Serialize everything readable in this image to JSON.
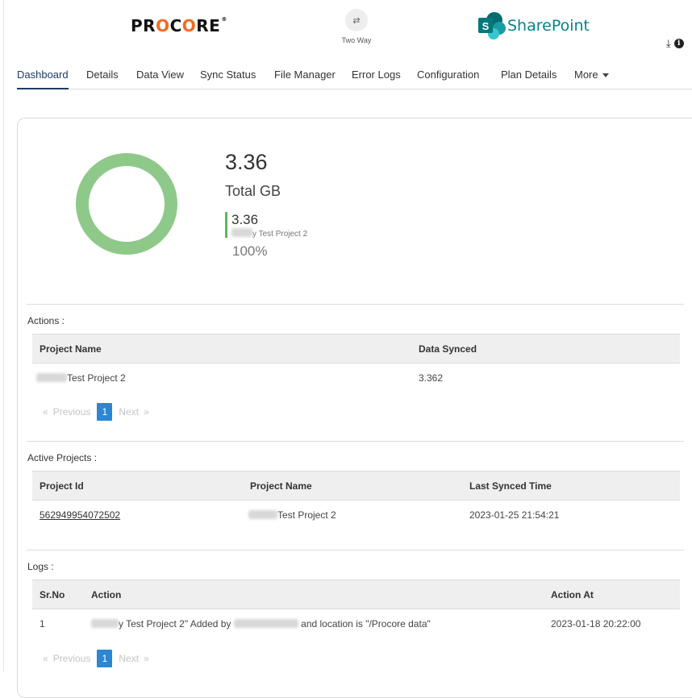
{
  "header": {
    "left_logo": "PROCORE",
    "sync_icon": "arrows-swap-icon",
    "sync_label": "Two Way",
    "right_logo": "SharePoint",
    "download_icon": "download-icon",
    "info_icon": "info-icon"
  },
  "tabs": [
    {
      "label": "Dashboard",
      "active": true
    },
    {
      "label": "Details"
    },
    {
      "label": "Data View"
    },
    {
      "label": "Sync Status"
    },
    {
      "label": "File Manager"
    },
    {
      "label": "Error Logs"
    },
    {
      "label": "Configuration"
    },
    {
      "label": "Plan Details"
    },
    {
      "label": "More"
    }
  ],
  "summary": {
    "total_value": "3.36",
    "total_unit": "Total GB",
    "legend_value": "3.36",
    "legend_name": "y Test Project 2",
    "legend_percent": "100%",
    "donut_share": 1.0,
    "donut_color": "#8fc98a"
  },
  "actions": {
    "title": "Actions :",
    "columns": [
      "Project Name",
      "Data Synced"
    ],
    "rows": [
      {
        "project_name": "Test Project 2",
        "data_synced": "3.362"
      }
    ],
    "pager": {
      "previous": "Previous",
      "page": "1",
      "next": "Next"
    }
  },
  "active_projects": {
    "title": "Active Projects :",
    "columns": [
      "Project Id",
      "Project Name",
      "Last Synced Time"
    ],
    "rows": [
      {
        "project_id": "562949954072502",
        "project_name": "Test Project 2",
        "last_synced": "2023-01-25 21:54:21"
      }
    ]
  },
  "logs": {
    "title": "Logs :",
    "columns": [
      "Sr.No",
      "Action",
      "Action At"
    ],
    "rows": [
      {
        "sr_no": "1",
        "action_a": "y Test Project 2\" Added by",
        "action_b": "and location is \"/Procore data\"",
        "action_at": "2023-01-18 20:22:00"
      }
    ],
    "pager": {
      "previous": "Previous",
      "page": "1",
      "next": "Next"
    }
  },
  "colors": {
    "accent": "#1f3b64",
    "pager_active": "#2b86d4",
    "sharepoint": "#048489"
  }
}
